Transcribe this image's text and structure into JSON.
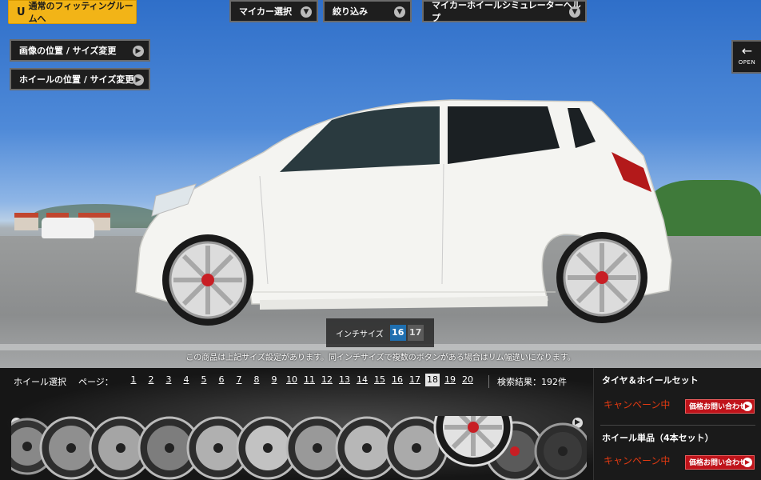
{
  "header": {
    "fitting_room_link": "通常のフィッティングルームへ",
    "menu": [
      {
        "label": "マイカー選択"
      },
      {
        "label": "絞り込み"
      },
      {
        "label": "マイカーホイールシミュレーターヘルプ"
      }
    ],
    "open_label": "OPEN"
  },
  "tools": {
    "image_resize": "画像の位置 / サイズ変更",
    "wheel_resize": "ホイールの位置 / サイズ変更"
  },
  "inch": {
    "label": "インチサイズ",
    "options": [
      "16",
      "17"
    ],
    "selected": "16"
  },
  "notice": "この商品は上記サイズ設定があります。同インチサイズで複数のボタンがある場合はリム幅違いになります。",
  "wheel_list": {
    "label": "ホイール選択",
    "page_label": "ページ：",
    "pages": [
      "1",
      "2",
      "3",
      "4",
      "5",
      "6",
      "7",
      "8",
      "9",
      "10",
      "11",
      "12",
      "13",
      "14",
      "15",
      "16",
      "17",
      "18",
      "19",
      "20"
    ],
    "current_page": "18",
    "results": "検索結果：192件"
  },
  "side": {
    "set_title": "タイヤ＆ホイールセット",
    "set_campaign": "キャンペーン中",
    "set_inquiry": "価格お問い合わせ",
    "single_title": "ホイール単品（4本セット）",
    "single_campaign": "キャンペーン中",
    "single_inquiry": "価格お問い合わせ"
  },
  "colors": {
    "accent_yellow": "#f2b417",
    "campaign_red": "#e23a12",
    "inquiry_button": "#c0131a",
    "inch_selected": "#1f6fb0"
  },
  "icons": [
    "chevron-down-icon",
    "arrow-left-icon",
    "chevron-right-icon",
    "u-logo-icon"
  ]
}
